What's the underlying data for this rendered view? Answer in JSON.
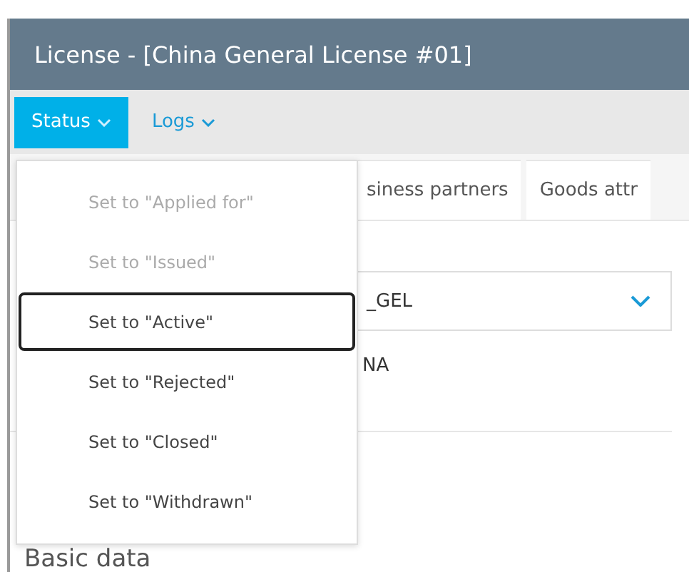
{
  "window": {
    "title": "License - [China General License #01]"
  },
  "toolbar": [
    {
      "label": "Status",
      "selected": true
    },
    {
      "label": "Logs",
      "selected": false
    }
  ],
  "tabs": [
    {
      "label": "siness partners"
    },
    {
      "label": "Goods attr"
    }
  ],
  "form": {
    "select_value": "_GEL",
    "field_value": "NA",
    "section_title": "Basic data"
  },
  "status_menu": [
    {
      "label": "Set to \"Applied for\"",
      "disabled": true,
      "focused": false
    },
    {
      "label": "Set to \"Issued\"",
      "disabled": true,
      "focused": false
    },
    {
      "label": "Set to \"Active\"",
      "disabled": false,
      "focused": true
    },
    {
      "label": "Set to \"Rejected\"",
      "disabled": false,
      "focused": false
    },
    {
      "label": "Set to \"Closed\"",
      "disabled": false,
      "focused": false
    },
    {
      "label": "Set to \"Withdrawn\"",
      "disabled": false,
      "focused": false
    }
  ]
}
